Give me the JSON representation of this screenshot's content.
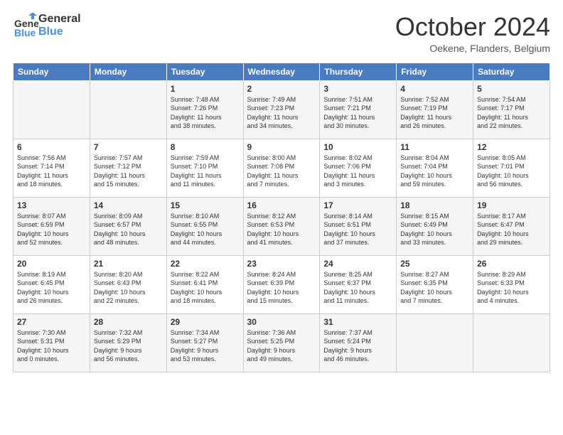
{
  "logo": {
    "text_general": "General",
    "text_blue": "Blue"
  },
  "title": "October 2024",
  "subtitle": "Oekene, Flanders, Belgium",
  "days_of_week": [
    "Sunday",
    "Monday",
    "Tuesday",
    "Wednesday",
    "Thursday",
    "Friday",
    "Saturday"
  ],
  "weeks": [
    [
      {
        "day": "",
        "content": ""
      },
      {
        "day": "",
        "content": ""
      },
      {
        "day": "1",
        "content": "Sunrise: 7:48 AM\nSunset: 7:26 PM\nDaylight: 11 hours\nand 38 minutes."
      },
      {
        "day": "2",
        "content": "Sunrise: 7:49 AM\nSunset: 7:23 PM\nDaylight: 11 hours\nand 34 minutes."
      },
      {
        "day": "3",
        "content": "Sunrise: 7:51 AM\nSunset: 7:21 PM\nDaylight: 11 hours\nand 30 minutes."
      },
      {
        "day": "4",
        "content": "Sunrise: 7:52 AM\nSunset: 7:19 PM\nDaylight: 11 hours\nand 26 minutes."
      },
      {
        "day": "5",
        "content": "Sunrise: 7:54 AM\nSunset: 7:17 PM\nDaylight: 11 hours\nand 22 minutes."
      }
    ],
    [
      {
        "day": "6",
        "content": "Sunrise: 7:56 AM\nSunset: 7:14 PM\nDaylight: 11 hours\nand 18 minutes."
      },
      {
        "day": "7",
        "content": "Sunrise: 7:57 AM\nSunset: 7:12 PM\nDaylight: 11 hours\nand 15 minutes."
      },
      {
        "day": "8",
        "content": "Sunrise: 7:59 AM\nSunset: 7:10 PM\nDaylight: 11 hours\nand 11 minutes."
      },
      {
        "day": "9",
        "content": "Sunrise: 8:00 AM\nSunset: 7:08 PM\nDaylight: 11 hours\nand 7 minutes."
      },
      {
        "day": "10",
        "content": "Sunrise: 8:02 AM\nSunset: 7:06 PM\nDaylight: 11 hours\nand 3 minutes."
      },
      {
        "day": "11",
        "content": "Sunrise: 8:04 AM\nSunset: 7:04 PM\nDaylight: 10 hours\nand 59 minutes."
      },
      {
        "day": "12",
        "content": "Sunrise: 8:05 AM\nSunset: 7:01 PM\nDaylight: 10 hours\nand 56 minutes."
      }
    ],
    [
      {
        "day": "13",
        "content": "Sunrise: 8:07 AM\nSunset: 6:59 PM\nDaylight: 10 hours\nand 52 minutes."
      },
      {
        "day": "14",
        "content": "Sunrise: 8:09 AM\nSunset: 6:57 PM\nDaylight: 10 hours\nand 48 minutes."
      },
      {
        "day": "15",
        "content": "Sunrise: 8:10 AM\nSunset: 6:55 PM\nDaylight: 10 hours\nand 44 minutes."
      },
      {
        "day": "16",
        "content": "Sunrise: 8:12 AM\nSunset: 6:53 PM\nDaylight: 10 hours\nand 41 minutes."
      },
      {
        "day": "17",
        "content": "Sunrise: 8:14 AM\nSunset: 6:51 PM\nDaylight: 10 hours\nand 37 minutes."
      },
      {
        "day": "18",
        "content": "Sunrise: 8:15 AM\nSunset: 6:49 PM\nDaylight: 10 hours\nand 33 minutes."
      },
      {
        "day": "19",
        "content": "Sunrise: 8:17 AM\nSunset: 6:47 PM\nDaylight: 10 hours\nand 29 minutes."
      }
    ],
    [
      {
        "day": "20",
        "content": "Sunrise: 8:19 AM\nSunset: 6:45 PM\nDaylight: 10 hours\nand 26 minutes."
      },
      {
        "day": "21",
        "content": "Sunrise: 8:20 AM\nSunset: 6:43 PM\nDaylight: 10 hours\nand 22 minutes."
      },
      {
        "day": "22",
        "content": "Sunrise: 8:22 AM\nSunset: 6:41 PM\nDaylight: 10 hours\nand 18 minutes."
      },
      {
        "day": "23",
        "content": "Sunrise: 8:24 AM\nSunset: 6:39 PM\nDaylight: 10 hours\nand 15 minutes."
      },
      {
        "day": "24",
        "content": "Sunrise: 8:25 AM\nSunset: 6:37 PM\nDaylight: 10 hours\nand 11 minutes."
      },
      {
        "day": "25",
        "content": "Sunrise: 8:27 AM\nSunset: 6:35 PM\nDaylight: 10 hours\nand 7 minutes."
      },
      {
        "day": "26",
        "content": "Sunrise: 8:29 AM\nSunset: 6:33 PM\nDaylight: 10 hours\nand 4 minutes."
      }
    ],
    [
      {
        "day": "27",
        "content": "Sunrise: 7:30 AM\nSunset: 5:31 PM\nDaylight: 10 hours\nand 0 minutes."
      },
      {
        "day": "28",
        "content": "Sunrise: 7:32 AM\nSunset: 5:29 PM\nDaylight: 9 hours\nand 56 minutes."
      },
      {
        "day": "29",
        "content": "Sunrise: 7:34 AM\nSunset: 5:27 PM\nDaylight: 9 hours\nand 53 minutes."
      },
      {
        "day": "30",
        "content": "Sunrise: 7:36 AM\nSunset: 5:25 PM\nDaylight: 9 hours\nand 49 minutes."
      },
      {
        "day": "31",
        "content": "Sunrise: 7:37 AM\nSunset: 5:24 PM\nDaylight: 9 hours\nand 46 minutes."
      },
      {
        "day": "",
        "content": ""
      },
      {
        "day": "",
        "content": ""
      }
    ]
  ]
}
